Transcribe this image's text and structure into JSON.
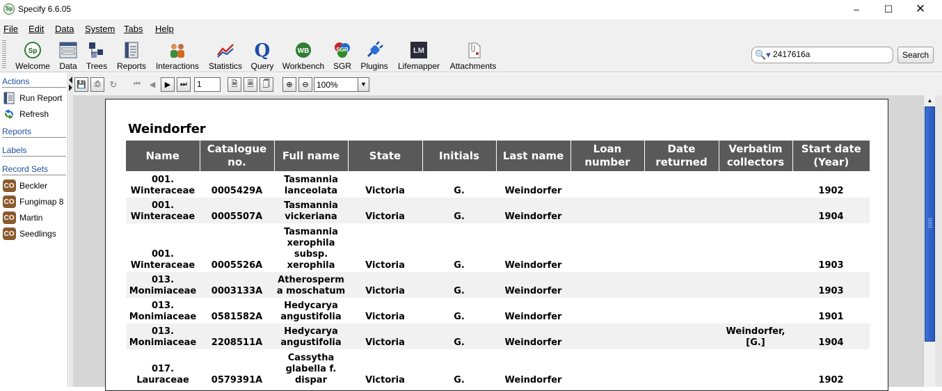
{
  "window": {
    "title": "Specify 6.6.05",
    "app_icon": "Sp"
  },
  "menu": [
    {
      "label": "File"
    },
    {
      "label": "Edit"
    },
    {
      "label": "Data"
    },
    {
      "label": "System"
    },
    {
      "label": "Tabs"
    },
    {
      "label": "Help"
    }
  ],
  "toolbar": {
    "welcome": "Welcome",
    "data": "Data",
    "trees": "Trees",
    "reports": "Reports",
    "interactions": "Interactions",
    "statistics": "Statistics",
    "query": "Query",
    "workbench": "Workbench",
    "sgr": "SGR",
    "plugins": "Plugins",
    "lifemapper": "Lifemapper",
    "attachments": "Attachments"
  },
  "search": {
    "value": "2417616a",
    "button": "Search"
  },
  "sidebar": {
    "actions": "Actions",
    "run_report": "Run Report",
    "refresh": "Refresh",
    "reports": "Reports",
    "labels": "Labels",
    "record_sets": "Record Sets",
    "record_set_badge": "CO",
    "sets": [
      "Beckler",
      "Fungimap 8",
      "Martin",
      "Seedlings"
    ]
  },
  "viewer": {
    "page": "1",
    "zoom": "100%"
  },
  "report": {
    "title": "Weindorfer",
    "headers": [
      "Name",
      "Catalogue no.",
      "Full name",
      "State",
      "Initials",
      "Last name",
      "Loan number",
      "Date returned",
      "Verbatim collectors",
      "Start date (Year)"
    ],
    "rows": [
      [
        "001. Winteraceae",
        "0005429A",
        "Tasmannia lanceolata",
        "Victoria",
        "G.",
        "Weindorfer",
        "",
        "",
        "",
        "1902"
      ],
      [
        "001. Winteraceae",
        "0005507A",
        "Tasmannia vickeriana",
        "Victoria",
        "G.",
        "Weindorfer",
        "",
        "",
        "",
        "1904"
      ],
      [
        "001. Winteraceae",
        "0005526A",
        "Tasmannia xerophila subsp. xerophila",
        "Victoria",
        "G.",
        "Weindorfer",
        "",
        "",
        "",
        "1903"
      ],
      [
        "013. Monimiaceae",
        "0003133A",
        "Atherosperm a moschatum",
        "Victoria",
        "G.",
        "Weindorfer",
        "",
        "",
        "",
        "1903"
      ],
      [
        "013. Monimiaceae",
        "0581582A",
        "Hedycarya angustifolia",
        "Victoria",
        "G.",
        "Weindorfer",
        "",
        "",
        "",
        "1901"
      ],
      [
        "013. Monimiaceae",
        "2208511A",
        "Hedycarya angustifolia",
        "Victoria",
        "G.",
        "Weindorfer",
        "",
        "",
        "Weindorfer, [G.]",
        "1904"
      ],
      [
        "017. Lauraceae",
        "0579391A",
        "Cassytha glabella f. dispar",
        "Victoria",
        "G.",
        "Weindorfer",
        "",
        "",
        "",
        "1902"
      ]
    ]
  }
}
